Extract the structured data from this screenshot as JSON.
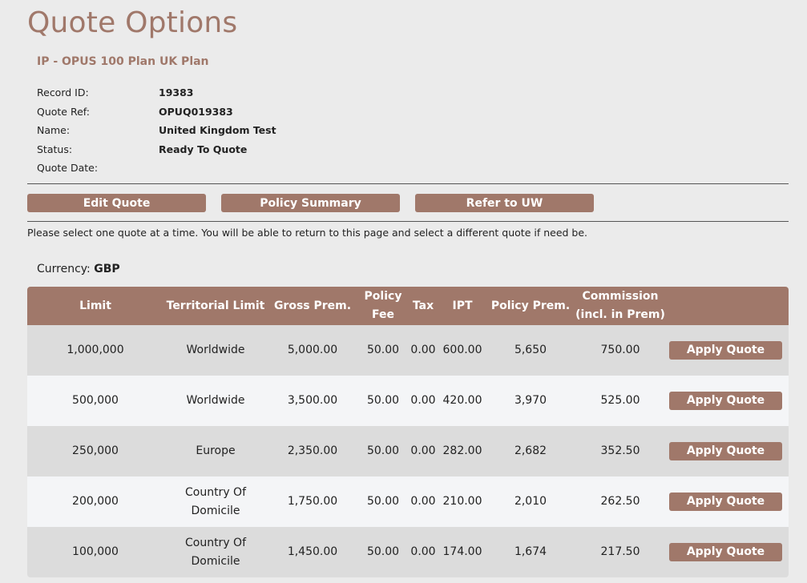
{
  "page": {
    "title": "Quote Options",
    "subtitle": "IP - OPUS 100 Plan UK Plan"
  },
  "details": [
    {
      "label": "Record ID:",
      "value": "19383"
    },
    {
      "label": "Quote Ref:",
      "value": "OPUQ019383"
    },
    {
      "label": "Name:",
      "value": "United Kingdom Test"
    },
    {
      "label": "Status:",
      "value": "Ready To Quote"
    },
    {
      "label": "Quote Date:",
      "value": ""
    }
  ],
  "actions": {
    "edit_quote": "Edit Quote",
    "policy_summary": "Policy Summary",
    "refer_to_uw": "Refer to UW"
  },
  "instructions": "Please select one quote at a time. You will be able to return to this page and select a different quote if need be.",
  "currency": {
    "label": "Currency:",
    "value": "GBP"
  },
  "table": {
    "headers": {
      "limit": "Limit",
      "territorial_limit": "Territorial Limit",
      "gross_prem": "Gross Prem.",
      "policy_fee": "Policy Fee",
      "tax": "Tax",
      "ipt": "IPT",
      "policy_prem": "Policy Prem.",
      "commission": "Commission (incl. in Prem)"
    },
    "apply_label": "Apply Quote",
    "rows": [
      {
        "limit": "1,000,000",
        "territorial_limit": "Worldwide",
        "gross_prem": "5,000.00",
        "policy_fee": "50.00",
        "tax": "0.00",
        "ipt": "600.00",
        "policy_prem": "5,650",
        "commission": "750.00"
      },
      {
        "limit": "500,000",
        "territorial_limit": "Worldwide",
        "gross_prem": "3,500.00",
        "policy_fee": "50.00",
        "tax": "0.00",
        "ipt": "420.00",
        "policy_prem": "3,970",
        "commission": "525.00"
      },
      {
        "limit": "250,000",
        "territorial_limit": "Europe",
        "gross_prem": "2,350.00",
        "policy_fee": "50.00",
        "tax": "0.00",
        "ipt": "282.00",
        "policy_prem": "2,682",
        "commission": "352.50"
      },
      {
        "limit": "200,000",
        "territorial_limit": "Country Of Domicile",
        "gross_prem": "1,750.00",
        "policy_fee": "50.00",
        "tax": "0.00",
        "ipt": "210.00",
        "policy_prem": "2,010",
        "commission": "262.50"
      },
      {
        "limit": "100,000",
        "territorial_limit": "Country Of Domicile",
        "gross_prem": "1,450.00",
        "policy_fee": "50.00",
        "tax": "0.00",
        "ipt": "174.00",
        "policy_prem": "1,674",
        "commission": "217.50"
      }
    ]
  }
}
